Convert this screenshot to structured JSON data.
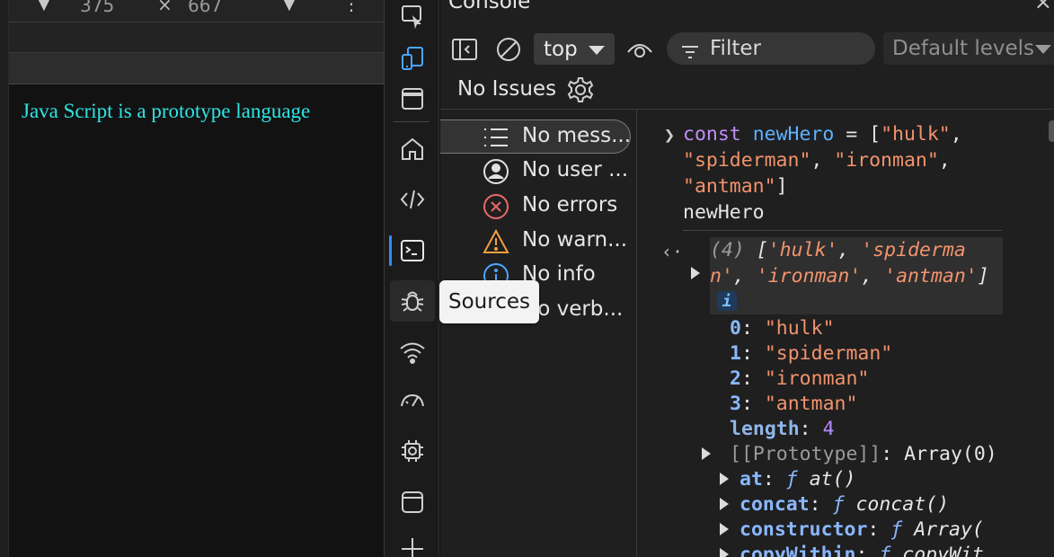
{
  "viewport": {
    "width_value": "375",
    "times": "×",
    "height_value": "667",
    "kebab": "⋮",
    "page_text": "Java Script is a prototype language"
  },
  "activity_bar": {
    "tooltip": "Sources",
    "items": [
      "inspect-icon",
      "device-emulation-icon",
      "window-icon",
      "home-icon",
      "elements-icon",
      "console-icon",
      "sources-bug-icon",
      "network-wifi-icon",
      "performance-icon",
      "memory-chip-icon",
      "application-icon",
      "add-icon"
    ]
  },
  "devtools": {
    "title": "Console",
    "close": "×",
    "context": "top",
    "filter_placeholder": "Filter",
    "levels": "Default levels",
    "issues": "No Issues"
  },
  "sidebar": {
    "items": [
      {
        "label": "No mess...",
        "icon": "list-icon"
      },
      {
        "label": "No user ...",
        "icon": "user-icon"
      },
      {
        "label": "No errors",
        "icon": "error-icon"
      },
      {
        "label": "No warn...",
        "icon": "warning-icon"
      },
      {
        "label": "No info",
        "icon": "info-icon"
      },
      {
        "label": "No verb...",
        "icon": "verbose-icon"
      }
    ]
  },
  "console": {
    "cmd_line1_kw": "const",
    "cmd_line1_var": "newHero",
    "cmd_line1_eq": " = [",
    "cmd_str1": "\"hulk\"",
    "cmd_comma": ",",
    "cmd_str2": "\"spiderman\"",
    "cmd_comma_sp": ", ",
    "cmd_str3": "\"ironman\"",
    "cmd_str4": "\"antman\"",
    "cmd_close": "]",
    "cmd_line4": "newHero",
    "result_count": "(4) ",
    "result_open": "[",
    "result_s1": "'hulk'",
    "result_c": ", ",
    "result_s2a": "'spiderma",
    "result_s2b": "n'",
    "result_s3": "'ironman'",
    "result_s4": "'antman'",
    "result_close": "]",
    "info_badge": "i",
    "entries": [
      {
        "key": "0",
        "value": "\"hulk\""
      },
      {
        "key": "1",
        "value": "\"spiderman\""
      },
      {
        "key": "2",
        "value": "\"ironman\""
      },
      {
        "key": "3",
        "value": "\"antman\""
      }
    ],
    "length_key": "length",
    "length_value": "4",
    "proto_key": "[[Prototype]]",
    "proto_value": "Array(0)",
    "methods": [
      {
        "key": "at",
        "value": "at()"
      },
      {
        "key": "concat",
        "value": "concat()"
      },
      {
        "key": "constructor",
        "value": "Array("
      },
      {
        "key": "copyWithin",
        "value": "copyWit"
      }
    ],
    "f_symbol": "ƒ",
    "colon": ": "
  },
  "colors": {
    "accent": "#2d8cff",
    "page_text": "#2ee6e6",
    "keyword": "#c18df7",
    "variable": "#5eb0ff",
    "string": "#f2936d"
  }
}
